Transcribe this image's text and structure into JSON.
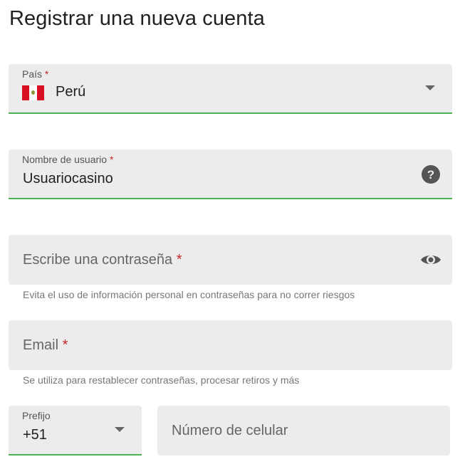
{
  "page": {
    "title": "Registrar una nueva cuenta"
  },
  "country": {
    "label": "País",
    "required_mark": "*",
    "value": "Perú",
    "flag": "peru-flag"
  },
  "username": {
    "label": "Nombre de usuario",
    "required_mark": "*",
    "value": "Usuariocasino",
    "icon": "help-icon"
  },
  "password": {
    "placeholder": "Escribe una contraseña",
    "required_mark": "*",
    "icon": "eye-icon",
    "helper": "Evita el uso de información personal en contraseñas para no correr riesgos"
  },
  "email": {
    "placeholder": "Email",
    "required_mark": "*",
    "helper": "Se utiliza para restablecer contraseñas, procesar retiros y más"
  },
  "prefix": {
    "label": "Prefijo",
    "value": "+51"
  },
  "phone": {
    "placeholder": "Número de celular"
  },
  "colors": {
    "accent_green": "#4caf50",
    "required_red": "#c62828",
    "field_bg": "#ececec"
  }
}
